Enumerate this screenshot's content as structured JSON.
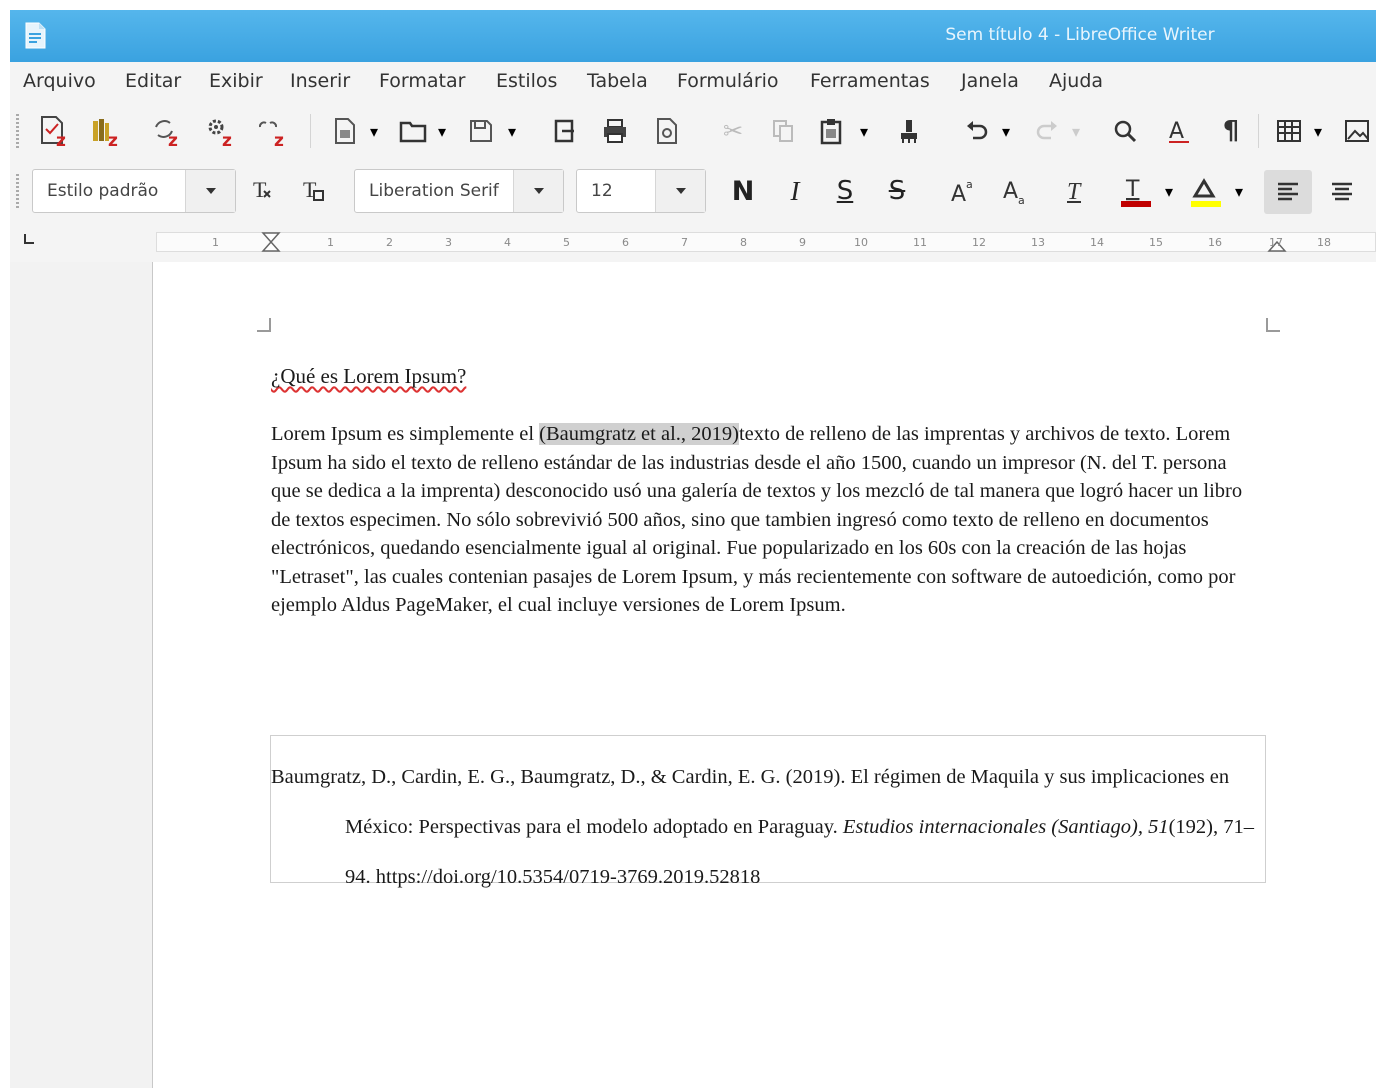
{
  "window": {
    "title": "Sem título 4 - LibreOffice Writer"
  },
  "menu": [
    "Arquivo",
    "Editar",
    "Exibir",
    "Inserir",
    "Formatar",
    "Estilos",
    "Tabela",
    "Formulário",
    "Ferramentas",
    "Janela",
    "Ajuda"
  ],
  "format_bar": {
    "paragraph_style": "Estilo padrão",
    "font_name": "Liberation Serif",
    "font_size": "12"
  },
  "ruler": {
    "ticks": [
      "1",
      "1",
      "2",
      "3",
      "4",
      "5",
      "6",
      "7",
      "8",
      "9",
      "10",
      "11",
      "12",
      "13",
      "14",
      "15",
      "16",
      "17",
      "18"
    ]
  },
  "document": {
    "heading": "¿Qué es Lorem Ipsum?",
    "paragraph_before": "Lorem Ipsum es simplemente el ",
    "citation": "(Baumgratz et al., 2019)",
    "paragraph_after": "texto de relleno de las imprentas y archivos de texto. Lorem Ipsum ha sido el texto de relleno estándar de las industrias desde el año 1500, cuando un impresor (N. del T. persona que se dedica a la imprenta) desconocido usó una galería de textos y los mezcló de tal manera que logró hacer un libro de textos especimen. No sólo sobrevivió 500 años, sino que tambien ingresó como texto de relleno en documentos electrónicos, quedando esencialmente igual al original. Fue popularizado en los 60s con la creación de las hojas \"Letraset\", las cuales contenian pasajes de Lorem Ipsum, y más recientemente con software de autoedición, como por ejemplo Aldus PageMaker, el cual incluye versiones de Lorem Ipsum.",
    "bibliography": {
      "authors": "Baumgratz, D., Cardin, E. G., Baumgratz, D., & Cardin, E. G. (2019). El régimen de Maquila y sus implicaciones en México: Perspectivas para el modelo adoptado en Paraguay. ",
      "journal": "Estudios internacionales (Santiago), 51",
      "rest": "(192), 71–94. https://doi.org/10.5354/0719-3769.2019.52818"
    }
  },
  "colors": {
    "titlebar": "#3aa2e0",
    "font_color": "#c00000",
    "highlight": "#ffff00",
    "citation_field": "#d0d0d0"
  }
}
